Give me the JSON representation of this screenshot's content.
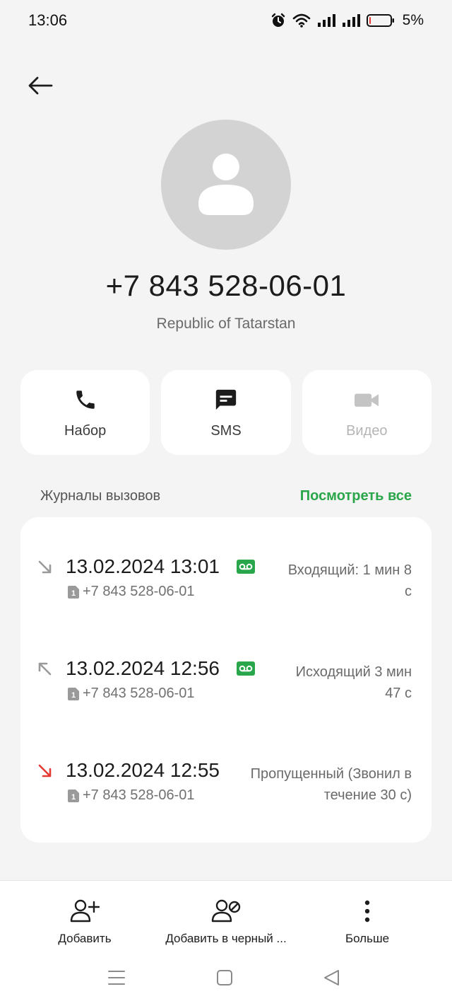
{
  "status_bar": {
    "time": "13:06",
    "battery": "5%",
    "icons": [
      "alarm-icon",
      "wifi-icon",
      "signal-icon",
      "signal-icon",
      "battery-icon"
    ],
    "battery_level": 0.05,
    "battery_color": "#e53935"
  },
  "contact": {
    "number": "+7 843 528-06-01",
    "region": "Republic of Tatarstan"
  },
  "actions": [
    {
      "label": "Набор",
      "icon": "phone-icon",
      "enabled": true
    },
    {
      "label": "SMS",
      "icon": "message-icon",
      "enabled": true
    },
    {
      "label": "Видео",
      "icon": "video-icon",
      "enabled": false
    }
  ],
  "call_log": {
    "title": "Журналы вызовов",
    "see_all": "Посмотреть все",
    "accent_color": "#2aa64a",
    "missed_color": "#e53935",
    "entries": [
      {
        "datetime": "13.02.2024 13:01",
        "number": "+7 843 528-06-01",
        "sim": "1",
        "direction": "incoming",
        "icon": "incoming-call-icon",
        "has_recording": true,
        "status": "Входящий:  1 мин 8\nс"
      },
      {
        "datetime": "13.02.2024 12:56",
        "number": "+7 843 528-06-01",
        "sim": "1",
        "direction": "outgoing",
        "icon": "outgoing-call-icon",
        "has_recording": true,
        "status": "Исходящий  3 мин\n47 с"
      },
      {
        "datetime": "13.02.2024 12:55",
        "number": "+7 843 528-06-01",
        "sim": "1",
        "direction": "missed",
        "icon": "missed-call-icon",
        "has_recording": false,
        "status": "Пропущенный (Звонил в\nтечение 30 с)"
      }
    ]
  },
  "toolbar": {
    "add_label": "Добавить",
    "block_label": "Добавить в черный ...",
    "more_label": "Больше"
  },
  "nav": {
    "icons": [
      "menu-icon",
      "home-icon",
      "back-icon"
    ]
  }
}
